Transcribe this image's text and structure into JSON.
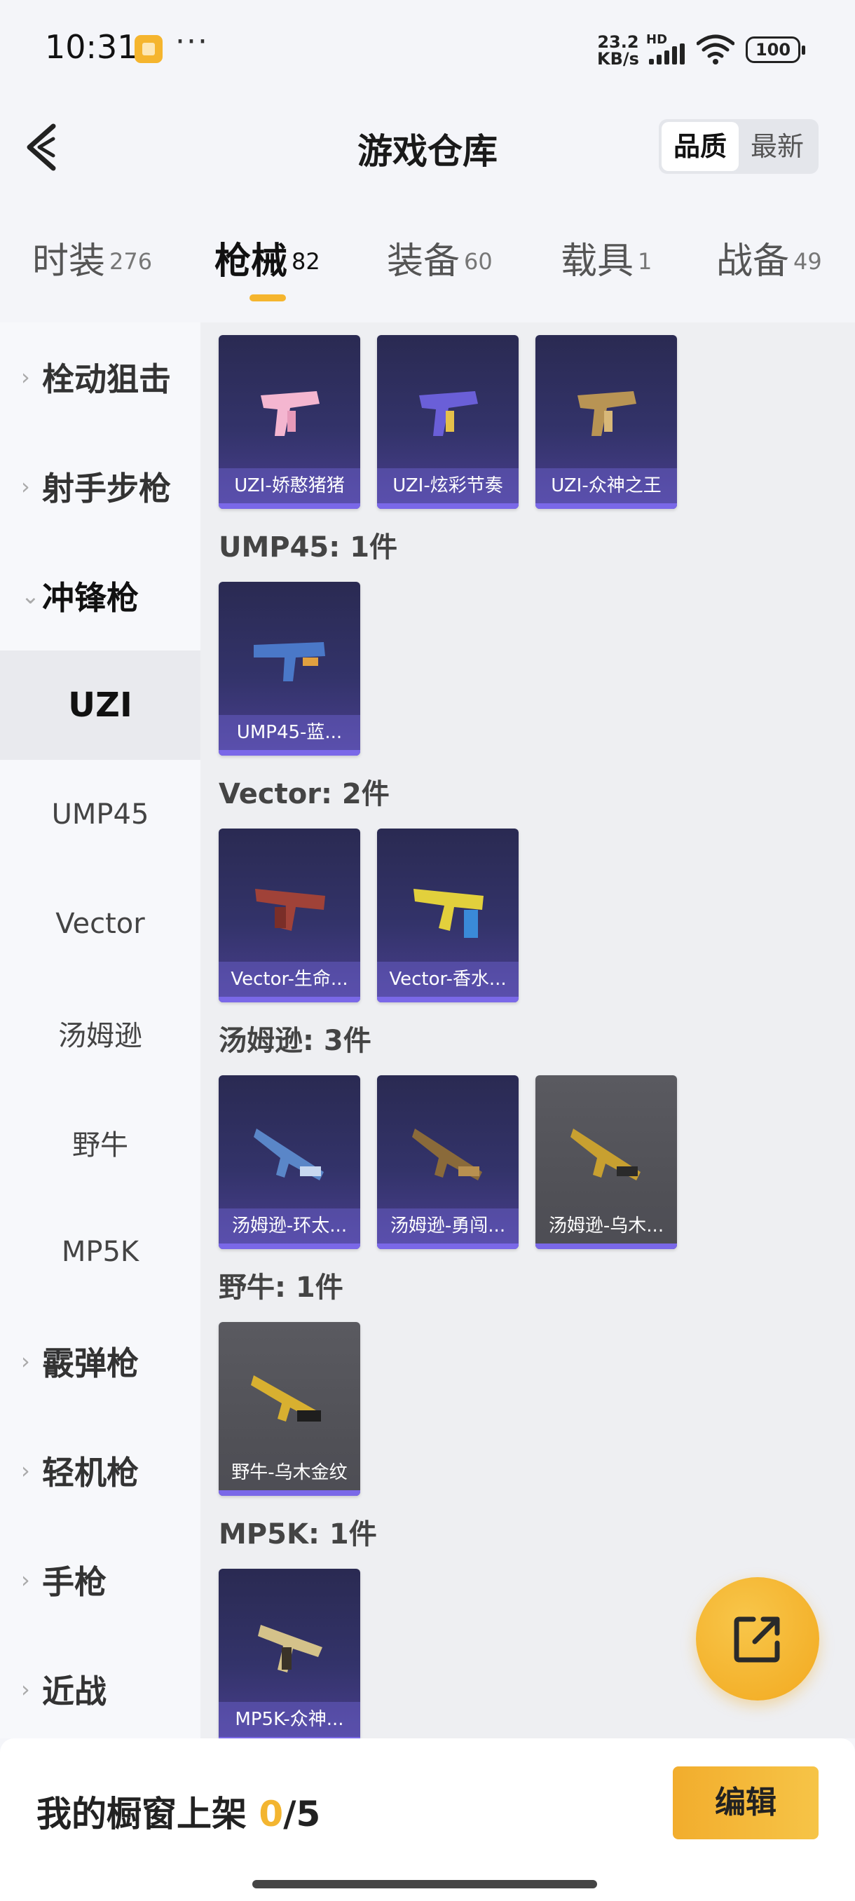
{
  "status_bar": {
    "time": "10:31",
    "more": "···",
    "net_speed_value": "23.2",
    "net_speed_unit": "KB/s",
    "hd": "HD",
    "battery": "100"
  },
  "header": {
    "title": "游戏仓库",
    "sort_options": [
      "品质",
      "最新"
    ],
    "sort_selected": "品质"
  },
  "category_tabs": [
    {
      "label": "时装",
      "count": "276"
    },
    {
      "label": "枪械",
      "count": "82",
      "active": true
    },
    {
      "label": "装备",
      "count": "60"
    },
    {
      "label": "载具",
      "count": "1"
    },
    {
      "label": "战备",
      "count": "49"
    }
  ],
  "sidebar": {
    "items": [
      {
        "label": "栓动狙击",
        "type": "group"
      },
      {
        "label": "射手步枪",
        "type": "group"
      },
      {
        "label": "冲锋枪",
        "type": "group",
        "open": true
      },
      {
        "label": "UZI",
        "type": "sub",
        "active": true
      },
      {
        "label": "UMP45",
        "type": "sub"
      },
      {
        "label": "Vector",
        "type": "sub"
      },
      {
        "label": "汤姆逊",
        "type": "sub"
      },
      {
        "label": "野牛",
        "type": "sub"
      },
      {
        "label": "MP5K",
        "type": "sub"
      },
      {
        "label": "霰弹枪",
        "type": "group"
      },
      {
        "label": "轻机枪",
        "type": "group"
      },
      {
        "label": "手枪",
        "type": "group"
      },
      {
        "label": "近战",
        "type": "group"
      }
    ]
  },
  "sections": [
    {
      "title": "",
      "items": [
        "UZI-娇憨猪猪",
        "UZI-炫彩节奏",
        "UZI-众神之王"
      ]
    },
    {
      "title": "UMP45: 1件",
      "items": [
        "UMP45-蓝..."
      ]
    },
    {
      "title": "Vector: 2件",
      "items": [
        "Vector-生命...",
        "Vector-香水..."
      ]
    },
    {
      "title": "汤姆逊: 3件",
      "items": [
        "汤姆逊-环太...",
        "汤姆逊-勇闯...",
        "汤姆逊-乌木..."
      ]
    },
    {
      "title": "野牛: 1件",
      "items": [
        "野牛-乌木金纹"
      ]
    },
    {
      "title": "MP5K: 1件",
      "items": [
        "MP5K-众神..."
      ]
    }
  ],
  "bottom_bar": {
    "showcase_label": "我的橱窗上架",
    "showcase_current": "0",
    "showcase_total": "/5",
    "edit_label": "编辑"
  },
  "colors": {
    "accent": "#f5b52e",
    "card_purple": "#33336a",
    "card_grey": "#505056",
    "rarity_strip": "#7a68e8"
  }
}
